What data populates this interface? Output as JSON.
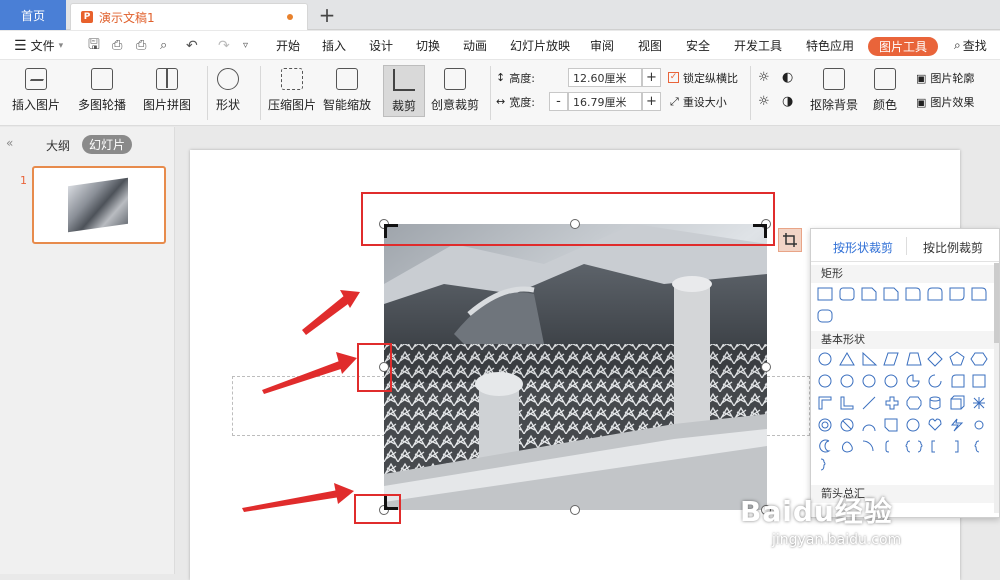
{
  "tabs": {
    "home": "首页",
    "doc": "演示文稿1",
    "new_tab": "+"
  },
  "menu": {
    "file": "文件",
    "items": [
      "开始",
      "插入",
      "设计",
      "切换",
      "动画",
      "幻灯片放映",
      "审阅",
      "视图",
      "安全",
      "开发工具",
      "特色应用"
    ],
    "tools": "图片工具",
    "find": "查找"
  },
  "ribbon": {
    "insert_image": "插入图片",
    "multi_carousel": "多图轮播",
    "image_collage": "图片拼图",
    "shape": "形状",
    "compress": "压缩图片",
    "smart_zoom": "智能缩放",
    "crop": "裁剪",
    "creative_crop": "创意裁剪",
    "height_label": "高度:",
    "height_value": "12.60厘米",
    "width_label": "宽度:",
    "width_value": "16.79厘米",
    "lock_ratio": "锁定纵横比",
    "reset_size": "重设大小",
    "remove_bg": "抠除背景",
    "color": "颜色",
    "outline": "图片轮廓",
    "effect": "图片效果",
    "plus": "+",
    "minus": "-"
  },
  "left_panel": {
    "outline_tab": "大纲",
    "slides_tab": "幻灯片",
    "slide_number": "1"
  },
  "crop_panel": {
    "tab_shape": "按形状裁剪",
    "tab_ratio": "按比例裁剪",
    "sec_rect": "矩形",
    "sec_basic": "基本形状",
    "sec_arrow": "箭头总汇"
  },
  "watermark": {
    "brand": "Baidu经验",
    "url": "jingyan.baidu.com"
  }
}
